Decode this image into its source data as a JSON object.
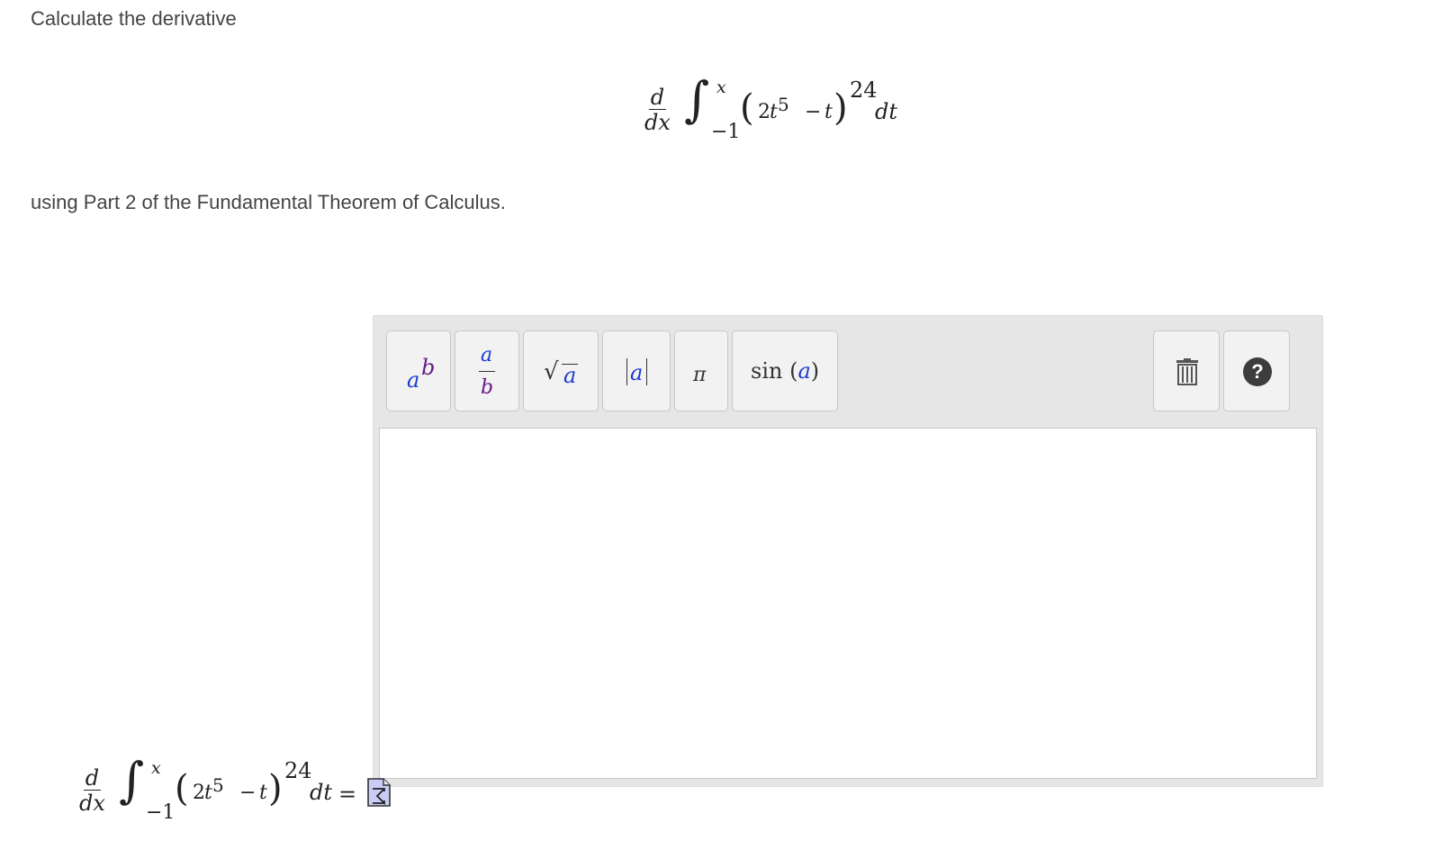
{
  "prompt": {
    "line1": "Calculate the derivative",
    "line2": "using Part 2 of the Fundamental Theorem of Calculus."
  },
  "expression": {
    "d": "d",
    "dx": "dx",
    "integral": "∫",
    "upper": "x",
    "lower": "−1",
    "open_paren": "(",
    "coef": "2",
    "t1": "t",
    "exp1": "5",
    "minus": "−",
    "t2": "t",
    "close_paren": ")",
    "power": "24",
    "dt": "dt",
    "equals": "="
  },
  "toolbar": {
    "power_base": "a",
    "power_exp": "b",
    "frac_num": "a",
    "frac_den": "b",
    "sqrt_symbol": "√",
    "sqrt_arg": "a",
    "abs_arg": "a",
    "pi_symbol": "π",
    "sin_func": "sin",
    "sin_arg": "a",
    "help_symbol": "?",
    "icons": {
      "trash": "trash-icon",
      "help": "help-icon",
      "equation_editor": "equation-editor-icon"
    }
  },
  "answer": {
    "value": ""
  }
}
